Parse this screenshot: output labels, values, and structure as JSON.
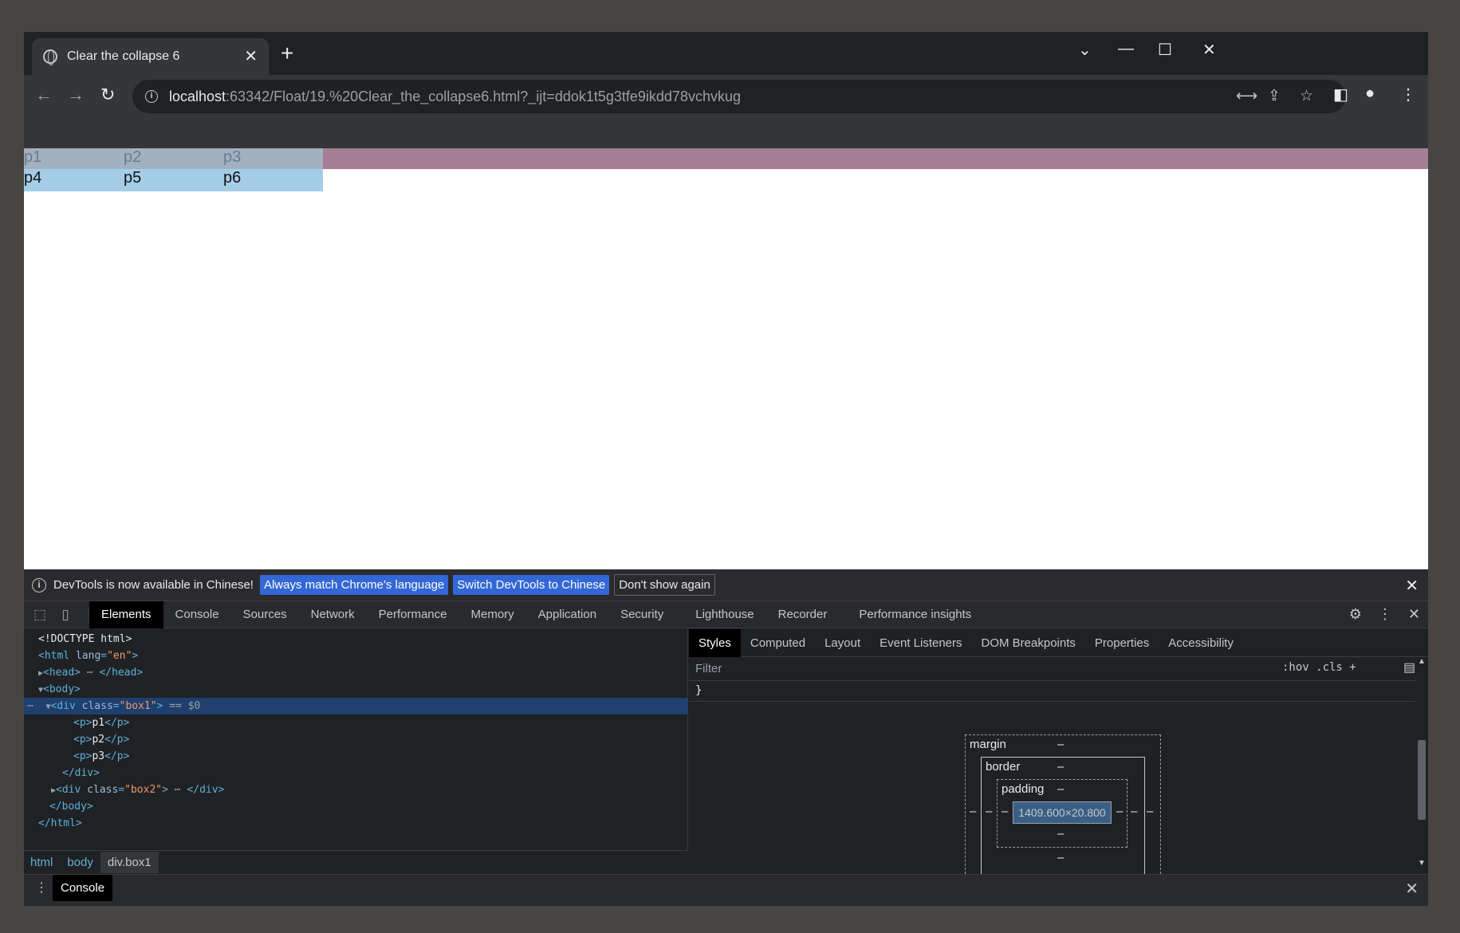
{
  "browser": {
    "tab_title": "Clear the collapse 6",
    "url_host": "localhost",
    "url_rest": ":63342/Float/19.%20Clear_the_collapse6.html?_ijt=ddok1t5g3tfe9ikdd78vchvkug"
  },
  "page": {
    "row1": [
      "p1",
      "p2",
      "p3"
    ],
    "row2": [
      "p4",
      "p5",
      "p6"
    ]
  },
  "devtools": {
    "banner": {
      "message": "DevTools is now available in Chinese!",
      "btn_match": "Always match Chrome's language",
      "btn_switch": "Switch DevTools to Chinese",
      "btn_dont": "Don't show again"
    },
    "tabs": [
      "Elements",
      "Console",
      "Sources",
      "Network",
      "Performance",
      "Memory",
      "Application",
      "Security",
      "Lighthouse",
      "Recorder",
      "Performance insights"
    ],
    "dom": {
      "doctype": "<!DOCTYPE html>",
      "html_open_tag": "<html ",
      "html_lang_attr": "lang",
      "html_lang_val": "\"en\"",
      "head": "<head>",
      "head_close": "</head>",
      "body_open": "<body>",
      "div_box1": "<div ",
      "class_attr": "class",
      "box1_val": "\"box1\"",
      "selected_marker": "== $0",
      "p_open": "<p>",
      "p_close": "</p>",
      "p1": "p1",
      "p2": "p2",
      "p3": "p3",
      "div_close": "</div>",
      "box2_val": "\"box2\"",
      "body_close": "</body>",
      "html_close": "</html>"
    },
    "breadcrumbs": [
      "html",
      "body",
      "div.box1"
    ],
    "styles_tabs": [
      "Styles",
      "Computed",
      "Layout",
      "Event Listeners",
      "DOM Breakpoints",
      "Properties",
      "Accessibility"
    ],
    "filter_placeholder": "Filter",
    "filter_tools": ":hov  .cls  +",
    "closing_brace": "}",
    "box_model": {
      "margin": "margin",
      "border": "border",
      "padding": "padding",
      "content": "1409.600×20.800",
      "dash": "–"
    },
    "drawer_tab": "Console"
  }
}
